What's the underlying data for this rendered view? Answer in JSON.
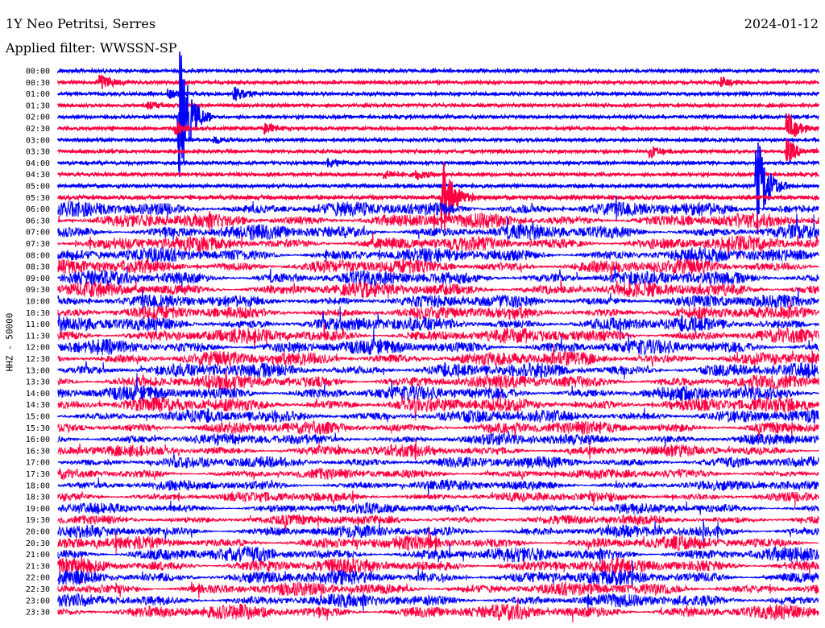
{
  "header": {
    "station": "1Y Neo Petritsi, Serres",
    "date": "2024-01-12",
    "filter": "Applied filter: WWSSN-SP"
  },
  "chart_data": {
    "type": "line",
    "subtype": "helicorder",
    "title": "1Y Neo Petritsi, Serres",
    "channel_label": "HHZ - 50000",
    "row_minutes": 30,
    "colors": [
      "#0000ff",
      "#ff0040"
    ],
    "row_labels": [
      "00:00",
      "00:30",
      "01:00",
      "01:30",
      "02:00",
      "02:30",
      "03:00",
      "03:30",
      "04:00",
      "04:30",
      "05:00",
      "05:30",
      "06:00",
      "06:30",
      "07:00",
      "07:30",
      "08:00",
      "08:30",
      "09:00",
      "09:30",
      "10:00",
      "10:30",
      "11:00",
      "11:30",
      "12:00",
      "12:30",
      "13:00",
      "13:30",
      "14:00",
      "14:30",
      "15:00",
      "15:30",
      "16:00",
      "16:30",
      "17:00",
      "17:30",
      "18:00",
      "18:30",
      "19:00",
      "19:30",
      "20:00",
      "20:30",
      "21:00",
      "21:30",
      "22:00",
      "22:30",
      "23:00",
      "23:30"
    ],
    "noise_level": [
      0.1,
      0.12,
      0.12,
      0.1,
      0.12,
      0.12,
      0.1,
      0.12,
      0.12,
      0.12,
      0.15,
      0.3,
      1.0,
      1.0,
      1.0,
      1.0,
      1.0,
      1.0,
      1.0,
      1.0,
      0.9,
      0.9,
      1.0,
      1.0,
      1.0,
      1.0,
      1.0,
      1.0,
      1.0,
      1.0,
      0.9,
      0.9,
      0.8,
      0.8,
      0.8,
      0.7,
      0.7,
      0.7,
      0.7,
      0.7,
      0.8,
      0.9,
      1.0,
      1.0,
      1.0,
      0.9,
      0.9,
      1.0
    ],
    "events": [
      {
        "row": 1,
        "minute": 1.7,
        "amp": 1.0
      },
      {
        "row": 1,
        "minute": 26.2,
        "amp": 0.6
      },
      {
        "row": 2,
        "minute": 4.4,
        "amp": 0.5
      },
      {
        "row": 2,
        "minute": 7.0,
        "amp": 0.8
      },
      {
        "row": 3,
        "minute": 3.6,
        "amp": 0.4
      },
      {
        "row": 4,
        "minute": 4.8,
        "amp": 9.0
      },
      {
        "row": 5,
        "minute": 4.7,
        "amp": 0.7
      },
      {
        "row": 5,
        "minute": 8.2,
        "amp": 0.6
      },
      {
        "row": 5,
        "minute": 28.8,
        "amp": 1.8
      },
      {
        "row": 6,
        "minute": 6.2,
        "amp": 0.4
      },
      {
        "row": 7,
        "minute": 23.4,
        "amp": 0.7
      },
      {
        "row": 7,
        "minute": 28.8,
        "amp": 1.4
      },
      {
        "row": 8,
        "minute": 10.7,
        "amp": 0.5
      },
      {
        "row": 9,
        "minute": 12.9,
        "amp": 0.5
      },
      {
        "row": 9,
        "minute": 14.2,
        "amp": 0.5
      },
      {
        "row": 10,
        "minute": 27.6,
        "amp": 6.0
      },
      {
        "row": 11,
        "minute": 15.2,
        "amp": 4.5
      }
    ]
  }
}
